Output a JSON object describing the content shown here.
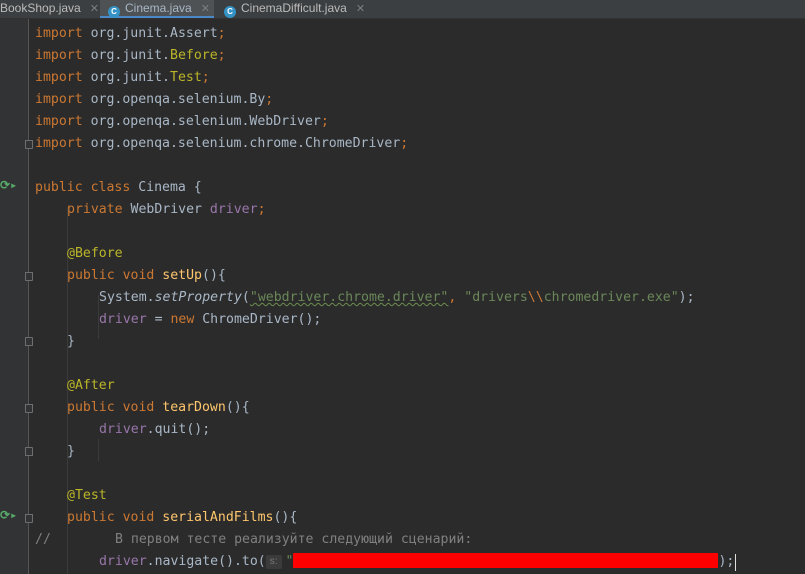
{
  "tabs": [
    {
      "label": "BookShop.java",
      "active": false
    },
    {
      "label": "Cinema.java",
      "active": true
    },
    {
      "label": "CinemaDifficult.java",
      "active": false
    }
  ],
  "code": {
    "imports": [
      {
        "kw": "import",
        "pkg": "org.junit.",
        "cls": "Assert",
        "semi": ";"
      },
      {
        "kw": "import",
        "pkg": "org.junit.",
        "cls": "Before",
        "semi": ";"
      },
      {
        "kw": "import",
        "pkg": "org.junit.",
        "cls": "Test",
        "semi": ";"
      },
      {
        "kw": "import",
        "pkg": "org.openqa.selenium.",
        "cls": "By",
        "semi": ";"
      },
      {
        "kw": "import",
        "pkg": "org.openqa.selenium.",
        "cls": "WebDriver",
        "semi": ";"
      },
      {
        "kw": "import",
        "pkg": "org.openqa.selenium.chrome.",
        "cls": "ChromeDriver",
        "semi": ";"
      }
    ],
    "class_decl": {
      "kw": "public class",
      "name": " Cinema {"
    },
    "field": {
      "kw": "private",
      "type": " WebDriver ",
      "name": "driver",
      "semi": ";"
    },
    "setup": {
      "ann": "@Before",
      "kw": "public void",
      "name": "setUp",
      "parens": "(){",
      "prop_prefix": "System.",
      "prop_call": "setProperty",
      "prop_open": "(",
      "str1": "\"webdriver.chrome.driver\"",
      "comma": ", ",
      "str2a": "\"drivers",
      "str2esc": "\\\\",
      "str2b": "chromedriver.exe\"",
      "prop_close": ");",
      "drv": "driver",
      "assign": " = ",
      "new_kw": "new",
      "ctor": " ChromeDriver();",
      "close": "}"
    },
    "teardown": {
      "ann": "@After",
      "kw": "public void",
      "name": "tearDown",
      "parens": "(){",
      "drv": "driver",
      "call": ".quit();",
      "close": "}"
    },
    "test": {
      "ann": "@Test",
      "kw": "public void",
      "name": "serialAndFilms",
      "parens": "(){",
      "comment_slashes": "//",
      "comment_text": "В первом тесте реализуйте следующий сценарий:",
      "drv": "driver",
      "nav": ".navigate().to(",
      "hint": "s:",
      "str_open": "\"",
      "tail": ");"
    }
  },
  "colors": {
    "background": "#2b2b2b",
    "keyword": "#cc7832",
    "annotation": "#bbb529",
    "field": "#9876aa",
    "method": "#ffc66d",
    "string": "#6a8759",
    "comment": "#808080",
    "redaction": "#ff0000"
  }
}
